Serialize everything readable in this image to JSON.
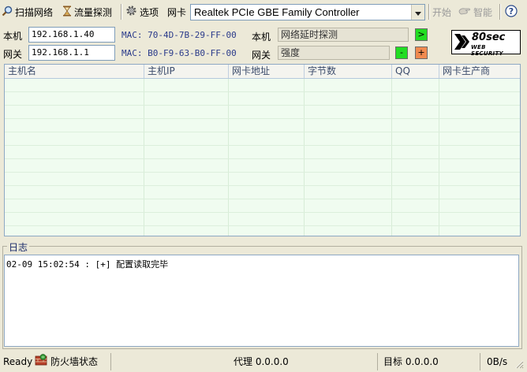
{
  "toolbar": {
    "scan_label": "扫描网络",
    "traffic_label": "流量探测",
    "options_label": "选项",
    "nic_label": "网卡",
    "nic_selected": "Realtek PCIe GBE Family Controller",
    "start_label": "开始",
    "smart_label": "智能",
    "help_icon": "help-icon"
  },
  "local": {
    "label": "本机",
    "ip": "192.168.1.40",
    "mac": "MAC: 70-4D-7B-29-FF-00",
    "probe_label": "本机",
    "probe_value": "网络延时探测",
    "go_button": ">"
  },
  "gateway": {
    "label": "网关",
    "ip": "192.168.1.1",
    "mac": "MAC: B0-F9-63-B0-FF-00",
    "strength_label": "网关",
    "strength_value": "强度",
    "minus_button": "-",
    "plus_button": "+"
  },
  "logo": {
    "text": "80sec",
    "sub": "WEB SECURITY"
  },
  "table": {
    "columns": [
      "主机名",
      "主机IP",
      "网卡地址",
      "字节数",
      "QQ",
      "网卡生产商"
    ],
    "rows": []
  },
  "log": {
    "title": "日志",
    "entries": [
      "02-09 15:02:54 : [+] 配置读取完毕"
    ]
  },
  "statusbar": {
    "ready": "Ready",
    "firewall": "防火墙状态",
    "proxy": "代理 0.0.0.0",
    "target": "目标 0.0.0.0",
    "rate": "0B/s"
  },
  "colors": {
    "go_button": "#22dd22",
    "minus_button": "#22dd22",
    "plus_button": "#f08a50",
    "grid_bg": "#f0fcf0"
  }
}
